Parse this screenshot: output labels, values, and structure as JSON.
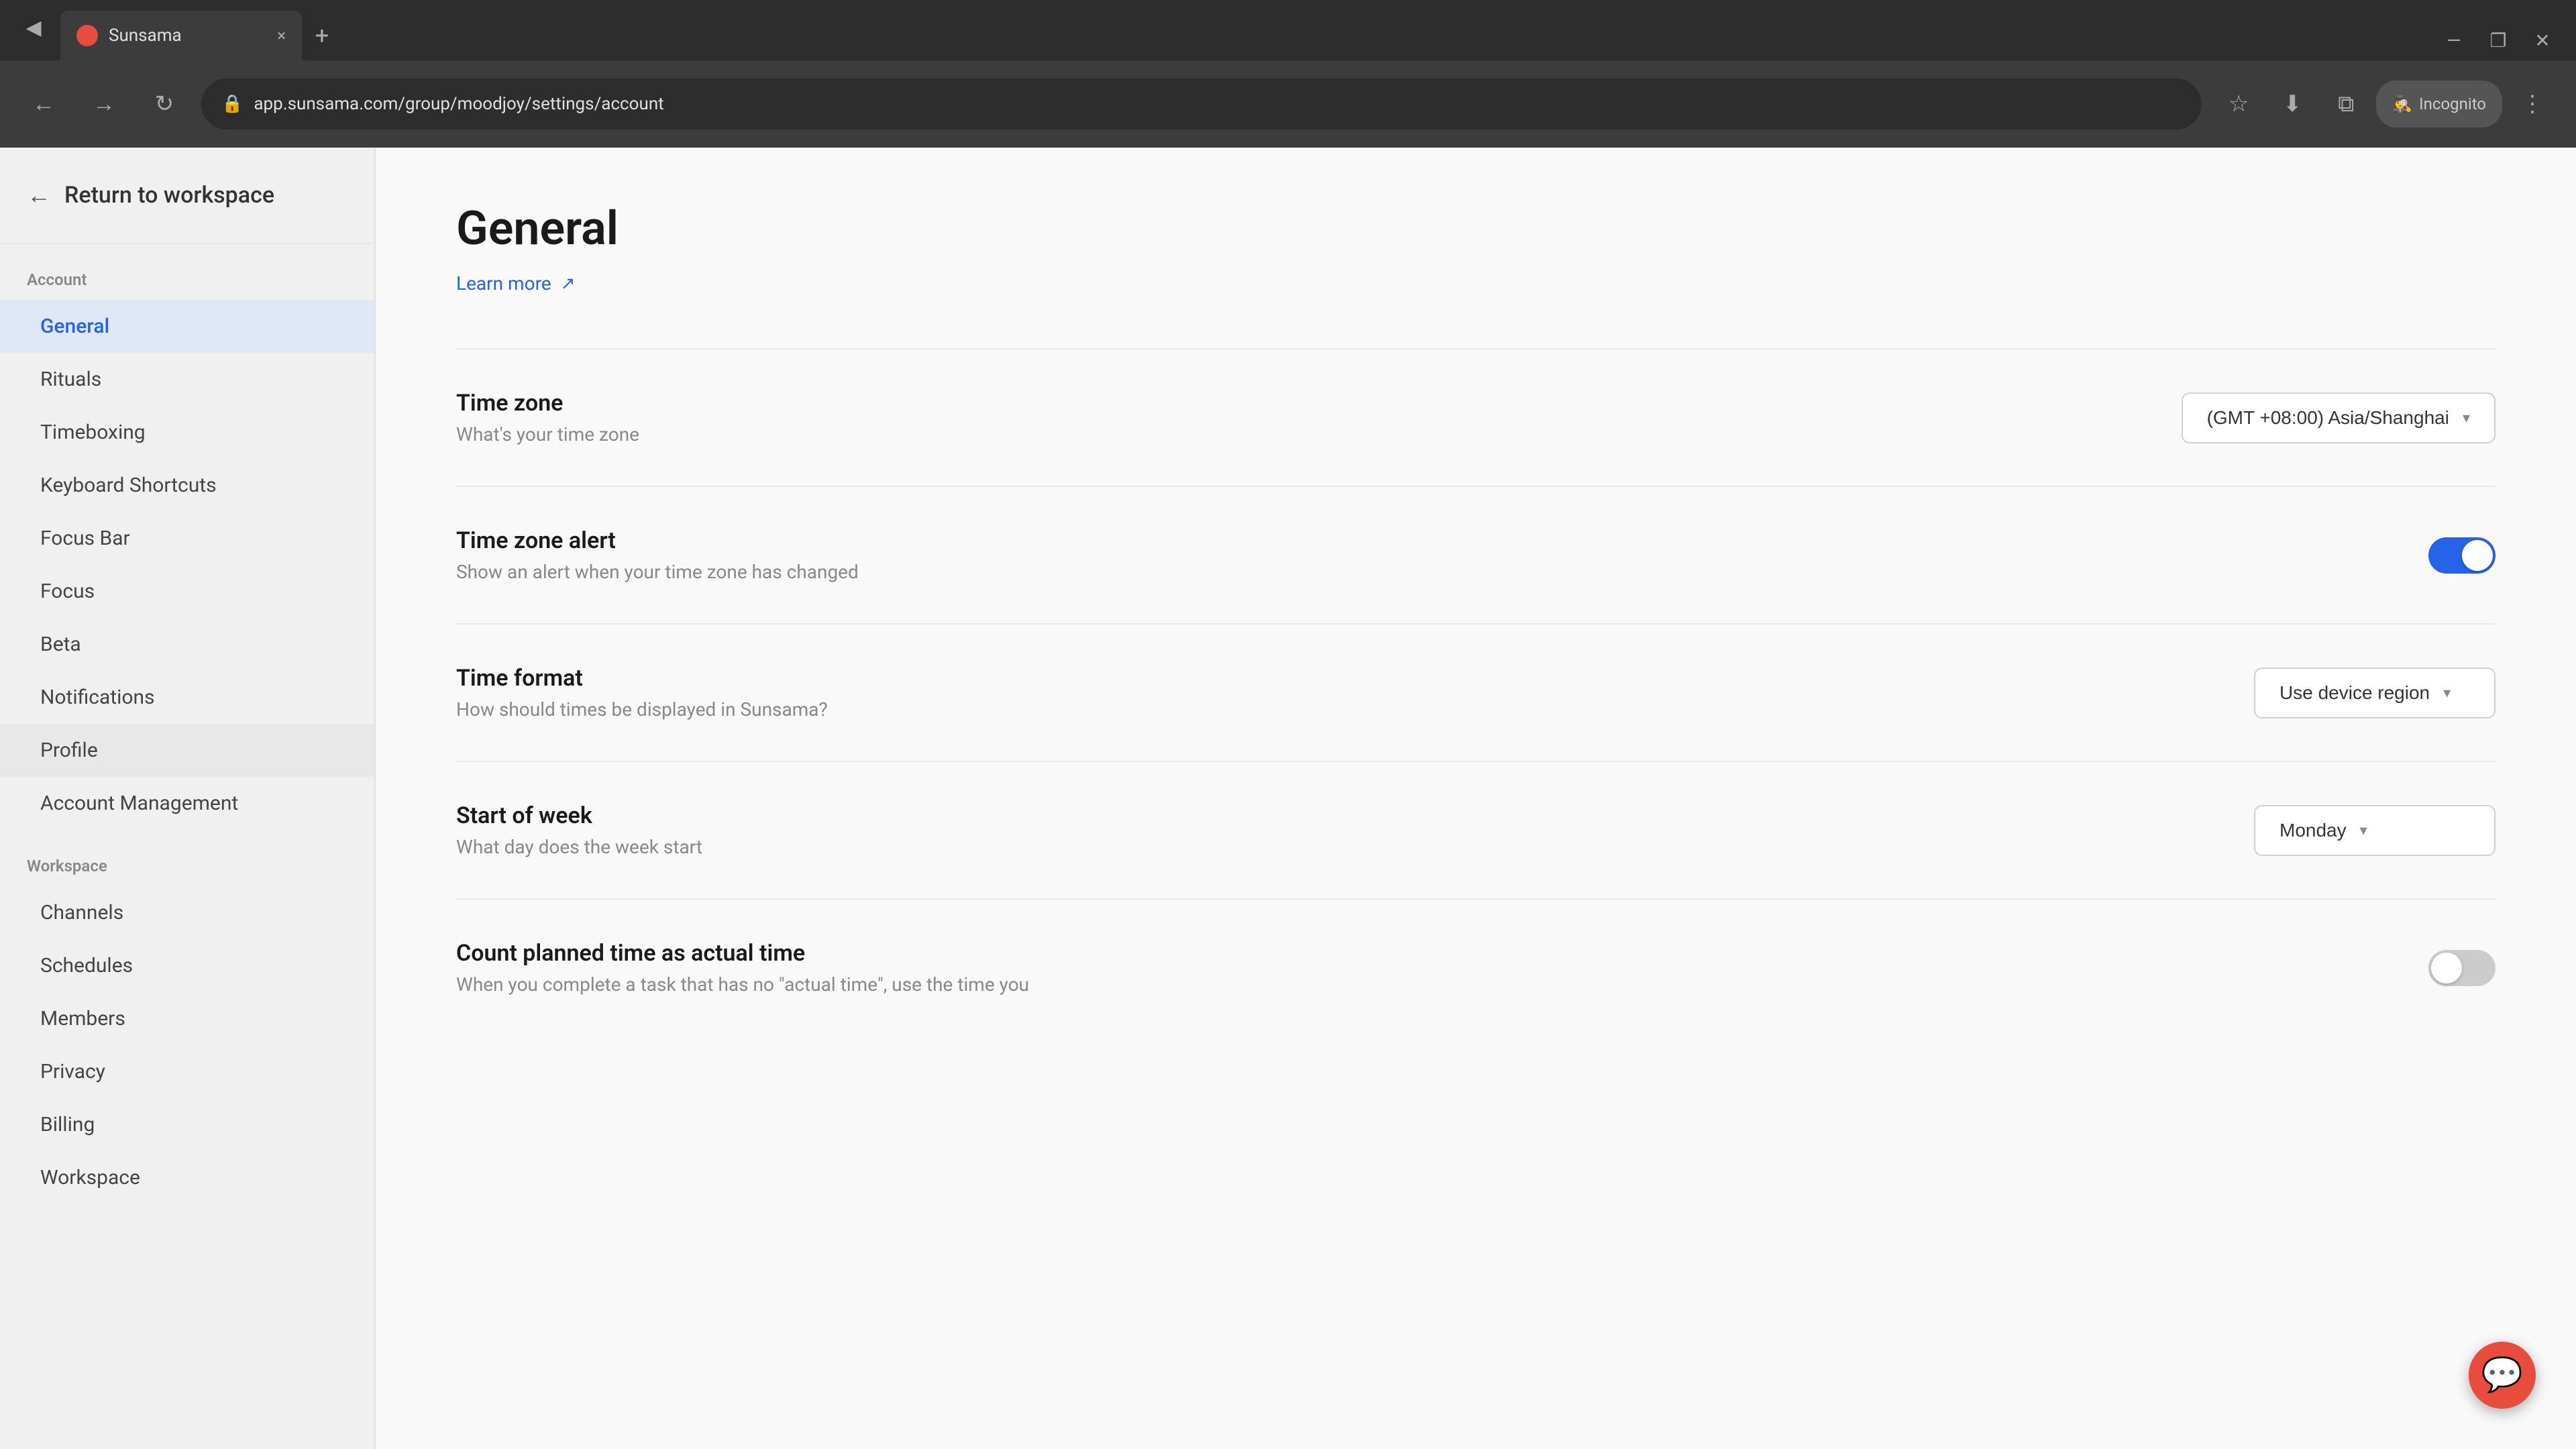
{
  "browser": {
    "tab_title": "Sunsama",
    "tab_close": "×",
    "tab_new": "+",
    "url": "app.sunsama.com/group/moodjoy/settings/account",
    "incognito_label": "Incognito",
    "nav": {
      "back": "←",
      "forward": "→",
      "reload": "↻",
      "more": "⋮"
    },
    "window_controls": {
      "minimize": "—",
      "maximize": "❐",
      "close": "✕"
    }
  },
  "return_to_workspace": "Return to workspace",
  "sidebar": {
    "account_section_label": "Account",
    "workspace_section_label": "Workspace",
    "account_items": [
      {
        "id": "general",
        "label": "General",
        "active": true
      },
      {
        "id": "rituals",
        "label": "Rituals"
      },
      {
        "id": "timeboxing",
        "label": "Timeboxing"
      },
      {
        "id": "keyboard-shortcuts",
        "label": "Keyboard Shortcuts"
      },
      {
        "id": "focus-bar",
        "label": "Focus Bar"
      },
      {
        "id": "focus",
        "label": "Focus"
      },
      {
        "id": "beta",
        "label": "Beta"
      },
      {
        "id": "notifications",
        "label": "Notifications"
      },
      {
        "id": "profile",
        "label": "Profile",
        "hovered": true
      },
      {
        "id": "account-management",
        "label": "Account Management"
      }
    ],
    "workspace_items": [
      {
        "id": "channels",
        "label": "Channels"
      },
      {
        "id": "schedules",
        "label": "Schedules"
      },
      {
        "id": "members",
        "label": "Members"
      },
      {
        "id": "privacy",
        "label": "Privacy"
      },
      {
        "id": "billing",
        "label": "Billing"
      },
      {
        "id": "workspace",
        "label": "Workspace"
      }
    ]
  },
  "main": {
    "title": "General",
    "learn_more_label": "Learn more",
    "sections": [
      {
        "id": "time-zone",
        "label": "Time zone",
        "description": "What's your time zone",
        "control_type": "dropdown",
        "control_value": "(GMT +08:00) Asia/Shanghai"
      },
      {
        "id": "time-zone-alert",
        "label": "Time zone alert",
        "description": "Show an alert when your time zone has changed",
        "control_type": "toggle",
        "toggle_on": true
      },
      {
        "id": "time-format",
        "label": "Time format",
        "description": "How should times be displayed in Sunsama?",
        "control_type": "dropdown",
        "control_value": "Use device region"
      },
      {
        "id": "start-of-week",
        "label": "Start of week",
        "description": "What day does the week start",
        "control_type": "dropdown",
        "control_value": "Monday"
      },
      {
        "id": "count-planned-time",
        "label": "Count planned time as actual time",
        "description": "When you complete a task that has no \"actual time\", use the time you",
        "control_type": "toggle",
        "toggle_on": false
      }
    ]
  },
  "chat_fab_icon": "💬"
}
